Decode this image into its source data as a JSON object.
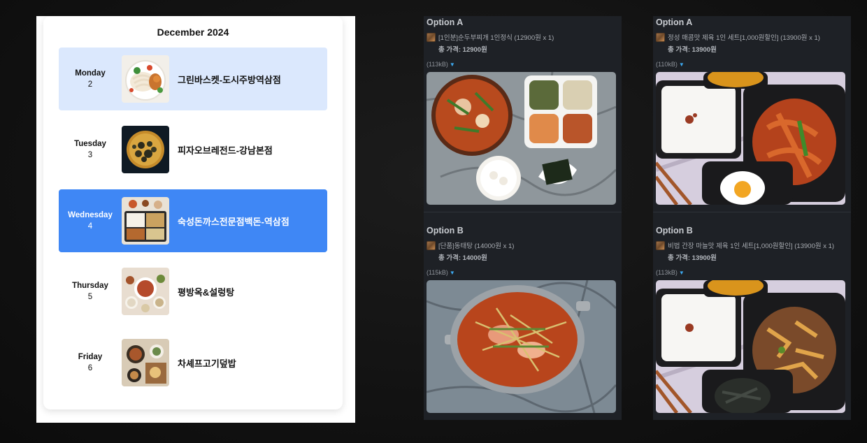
{
  "calendar": {
    "title": "December 2024",
    "days": [
      {
        "name": "Monday",
        "date": "2",
        "restaurant": "그린바스켓-도시주방역삼점",
        "state": "highlighted"
      },
      {
        "name": "Tuesday",
        "date": "3",
        "restaurant": "피자오브레전드-강남본점",
        "state": "default"
      },
      {
        "name": "Wednesday",
        "date": "4",
        "restaurant": "숙성돈까스전문점백돈-역삼점",
        "state": "selected"
      },
      {
        "name": "Thursday",
        "date": "5",
        "restaurant": "평방옥&설렁탕",
        "state": "default"
      },
      {
        "name": "Friday",
        "date": "6",
        "restaurant": "차셰프고기덮밥",
        "state": "default"
      }
    ]
  },
  "menus": [
    {
      "options": [
        {
          "title": "Option A",
          "item": "[1인분]순두부찌개 1인정식 (12900원 x 1)",
          "total": "총 가격: 12900원",
          "image_size": "(113kB)",
          "photo": "sundubu-set-photo"
        },
        {
          "title": "Option B",
          "item": "[단품]동태탕 (14000원 x 1)",
          "total": "총 가격: 14000원",
          "image_size": "(115kB)",
          "photo": "dongtae-stew-photo"
        }
      ]
    },
    {
      "options": [
        {
          "title": "Option A",
          "item": "정성 매콤맛 제육 1인 세트[1,000원할인] (13900원 x 1)",
          "total": "총 가격: 13900원",
          "image_size": "(110kB)",
          "photo": "spicy-pork-set-photo"
        },
        {
          "title": "Option B",
          "item": "비법 간장 마늘맛 제육 1인 세트[1,000원할인] (13900원 x 1)",
          "total": "총 가격: 13900원",
          "image_size": "(113kB)",
          "photo": "soy-garlic-pork-set-photo"
        }
      ]
    }
  ],
  "colors": {
    "highlight_row": "#dbe8fd",
    "selected_row": "#3f87f5",
    "panel_bg": "#1e2126",
    "size_caret": "#3da9f0"
  }
}
